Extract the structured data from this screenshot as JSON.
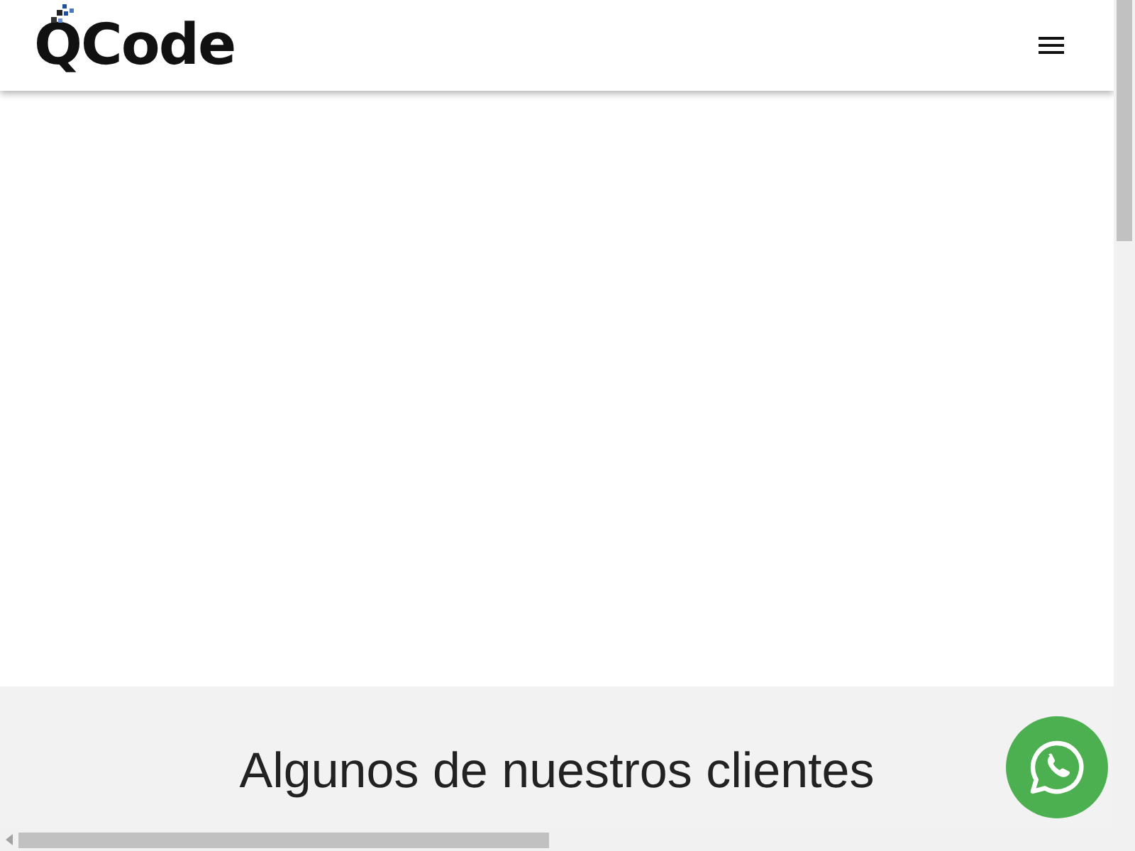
{
  "header": {
    "logo": "QCode"
  },
  "clients_section": {
    "title": "Algunos de nuestros clientes"
  }
}
